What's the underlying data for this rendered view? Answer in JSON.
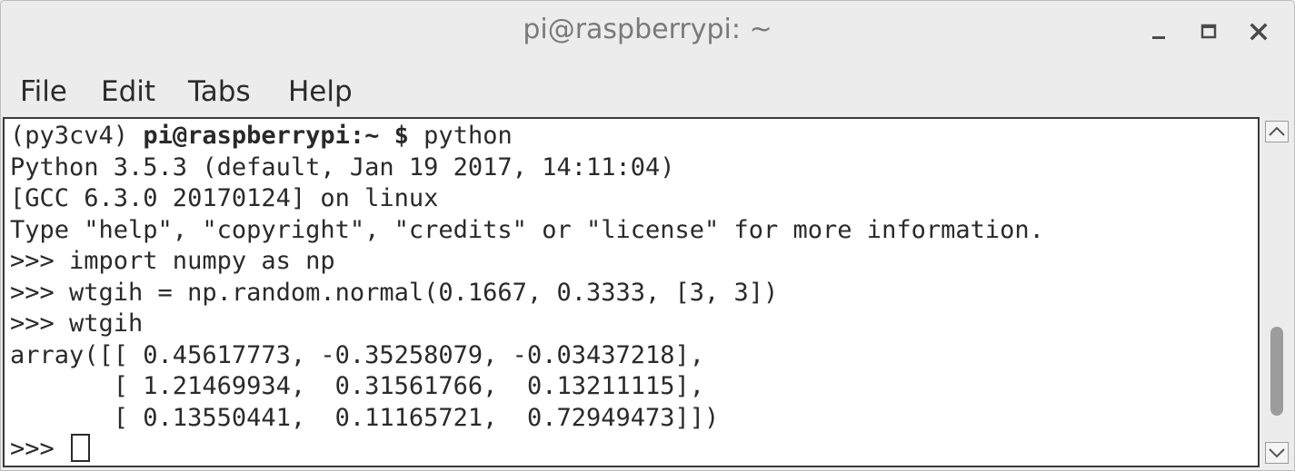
{
  "window": {
    "title": "pi@raspberrypi: ~",
    "controls": [
      "minimize-icon",
      "maximize-icon",
      "close-icon"
    ]
  },
  "menu": {
    "file": "File",
    "edit": "Edit",
    "tabs": "Tabs",
    "help": "Help"
  },
  "terminal": {
    "line0": {
      "env": "(py3cv4) ",
      "user_host": "pi@raspberrypi",
      "path_prompt": ":~ $",
      "command": " python"
    },
    "line1": "Python 3.5.3 (default, Jan 19 2017, 14:11:04)",
    "line2": "[GCC 6.3.0 20170124] on linux",
    "line3": "Type \"help\", \"copyright\", \"credits\" or \"license\" for more information.",
    "line4": ">>> import numpy as np",
    "line5": ">>> wtgih = np.random.normal(0.1667, 0.3333, [3, 3])",
    "line6": ">>> wtgih",
    "line7": "array([[ 0.45617773, -0.35258079, -0.03437218],",
    "line8": "       [ 1.21469934,  0.31561766,  0.13211115],",
    "line9": "       [ 0.13550441,  0.11165721,  0.72949473]])",
    "line10_prompt": ">>> "
  },
  "scrollbar": {
    "position_fraction": 0.88,
    "thumb_fraction": 0.3
  },
  "colors": {
    "window_bg": "#ececec",
    "terminal_bg": "#ffffff",
    "text": "#2a2a2a"
  }
}
